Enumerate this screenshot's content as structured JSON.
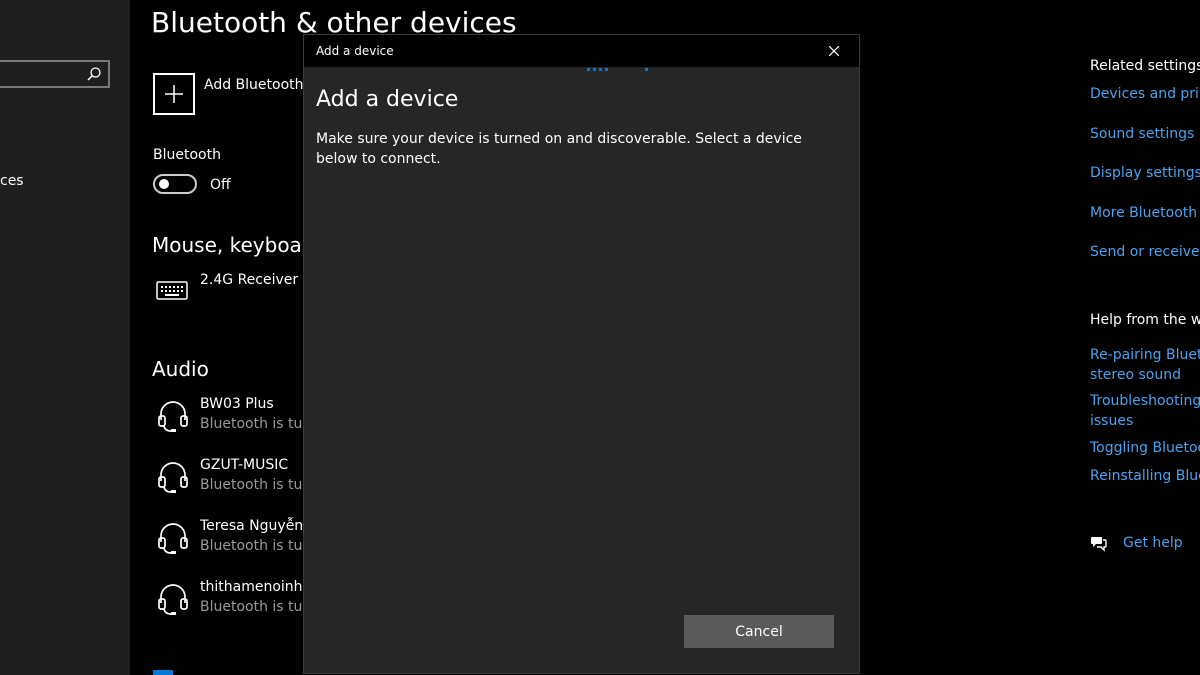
{
  "nav": {
    "partial_item": "ces"
  },
  "main": {
    "title": "Bluetooth & other devices",
    "add_label": "Add Bluetooth o",
    "bluetooth_label": "Bluetooth",
    "bluetooth_state": "Off",
    "mouse_heading": "Mouse, keyboard",
    "receiver_name": "2.4G Receiver",
    "audio_heading": "Audio",
    "audio_devices": [
      {
        "name": "BW03 Plus",
        "status": "Bluetooth is turn"
      },
      {
        "name": "GZUT-MUSIC",
        "status": "Bluetooth is turn"
      },
      {
        "name": "Teresa Nguyễn",
        "status": "Bluetooth is turn"
      },
      {
        "name": "thithamenoinho",
        "status": "Bluetooth is turn"
      }
    ]
  },
  "related": {
    "heading": "Related settings",
    "links": [
      "Devices and print",
      "Sound settings",
      "Display settings",
      "More Bluetooth o",
      "Send or receive fi"
    ],
    "help_heading": "Help from the we",
    "help_links": [
      [
        "Re-pairing Blueto",
        "stereo sound"
      ],
      [
        "Troubleshooting N",
        "issues"
      ],
      [
        "Toggling Bluetoot"
      ],
      [
        "Reinstalling Bluet"
      ]
    ],
    "get_help": "Get help"
  },
  "dialog": {
    "window_title": "Add a device",
    "heading": "Add a device",
    "description": "Make sure your device is turned on and discoverable. Select a device below to connect.",
    "cancel": "Cancel"
  },
  "colors": {
    "accent": "#0078d7",
    "link": "#4aa3ee",
    "dialog_bg": "#262626",
    "button": "#5a5a5a"
  },
  "icons": [
    "search-icon",
    "plus-icon",
    "keyboard-icon",
    "headset-icon",
    "close-icon",
    "chat-help-icon"
  ]
}
